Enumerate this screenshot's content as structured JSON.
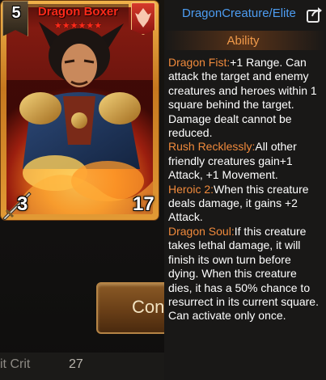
{
  "background": {
    "button_label": "Con",
    "stat_label": "it Crit",
    "stat_value": "27"
  },
  "card": {
    "name": "Dragon Boxer",
    "cost": "5",
    "stars": "★★★★★★",
    "attack": "3",
    "health": "17",
    "faction_icon": "dragon-emblem-icon",
    "colors": {
      "frame": "#e29a35",
      "name": "#ff2a1a",
      "badge": "#d63a2a"
    }
  },
  "info": {
    "type_label": "DragonCreature/Elite",
    "share_icon": "share-icon",
    "ability_header": "Ability",
    "abilities": [
      {
        "keyword": "Dragon Fist:",
        "text": "+1 Range. Can attack the target and enemy creatures and heroes within 1 square behind the target. Damage dealt cannot be reduced."
      },
      {
        "keyword": "Rush Recklessly:",
        "text": "All other friendly creatures gain+1 Attack, +1 Movement."
      },
      {
        "keyword": "Heroic 2:",
        "text": "When this creature deals damage, it gains +2 Attack."
      },
      {
        "keyword": "Dragon Soul:",
        "text": "If this creature takes lethal damage, it will finish its own turn before dying. When this creature dies, it has a 50% chance to resurrect in its current square. Can activate only once."
      }
    ],
    "colors": {
      "type": "#4d9df2",
      "keyword": "#f08a3c",
      "text": "#ffffff"
    }
  }
}
